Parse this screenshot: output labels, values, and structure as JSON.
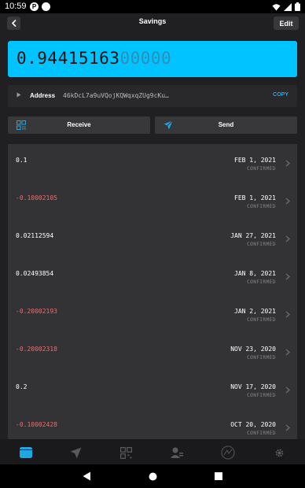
{
  "status_bar": {
    "time": "10:59"
  },
  "header": {
    "title": "Savings",
    "edit_label": "Edit"
  },
  "balance": {
    "value_main": "0.94415163",
    "value_dim": "00000"
  },
  "address": {
    "label": "Address",
    "value": "46kDcL7a9uVQojKQWqxqZUg9cKu…",
    "copy_label": "COPY"
  },
  "actions": {
    "receive_label": "Receive",
    "send_label": "Send"
  },
  "transactions": [
    {
      "amount": "0.1",
      "date": "FEB 1, 2021",
      "status": "CONFIRMED",
      "negative": false
    },
    {
      "amount": "-0.10002105",
      "date": "FEB 1, 2021",
      "status": "CONFIRMED",
      "negative": true
    },
    {
      "amount": "0.02112594",
      "date": "JAN 27, 2021",
      "status": "CONFIRMED",
      "negative": false
    },
    {
      "amount": "0.02493854",
      "date": "JAN 8, 2021",
      "status": "CONFIRMED",
      "negative": false
    },
    {
      "amount": "-0.20002193",
      "date": "JAN 2, 2021",
      "status": "CONFIRMED",
      "negative": true
    },
    {
      "amount": "-0.20002318",
      "date": "NOV 23, 2020",
      "status": "CONFIRMED",
      "negative": true
    },
    {
      "amount": "0.2",
      "date": "NOV 17, 2020",
      "status": "CONFIRMED",
      "negative": false
    },
    {
      "amount": "-0.10002428",
      "date": "OCT 20, 2020",
      "status": "CONFIRMED",
      "negative": true
    }
  ],
  "tabs": [
    {
      "icon": "wallet-icon",
      "active": true
    },
    {
      "icon": "send-icon",
      "active": false
    },
    {
      "icon": "qr-icon",
      "active": false
    },
    {
      "icon": "contacts-icon",
      "active": false
    },
    {
      "icon": "exchange-icon",
      "active": false
    },
    {
      "icon": "gear-icon",
      "active": false
    }
  ],
  "colors": {
    "accent": "#00c3ff",
    "negative": "#ef6a6a",
    "tab_active": "#1ea7e0"
  }
}
